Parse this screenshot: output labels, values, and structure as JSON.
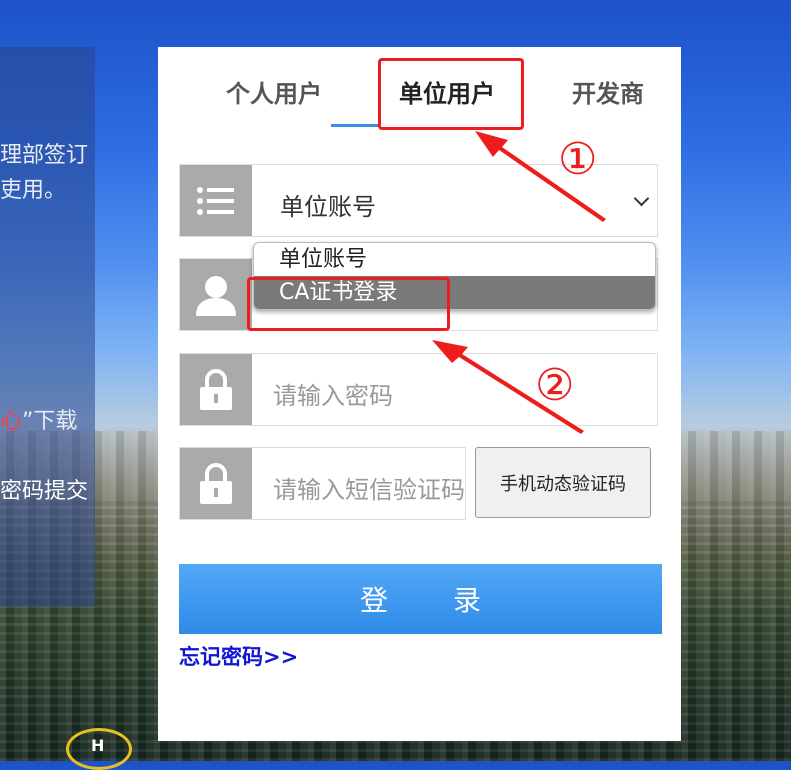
{
  "tabs": [
    {
      "label": "个人用户",
      "active": false
    },
    {
      "label": "单位用户",
      "active": true
    },
    {
      "label": "开发商",
      "active": false
    }
  ],
  "account_select": {
    "selected": "单位账号"
  },
  "dropdown": {
    "options": [
      "单位账号",
      "CA证书登录"
    ],
    "highlighted": "CA证书登录"
  },
  "password": {
    "placeholder": "请输入密码"
  },
  "sms": {
    "placeholder": "请输入短信验证码",
    "button": "手机动态验证码"
  },
  "login_button": "登 录",
  "forgot_link": "忘记密码>>",
  "left_panel": {
    "line1": "理部签订",
    "line2": "吏用。",
    "line3_red": "心",
    "line3_rest": "”下载",
    "line4": "密码提交"
  },
  "annotations": {
    "one": "①",
    "two": "②"
  },
  "colors": {
    "accent": "#3a8ee6",
    "annotation": "#ee1d1d",
    "link": "#0f14d6"
  },
  "icons": [
    "list-icon",
    "user-icon",
    "lock-icon",
    "chevron-down-icon"
  ]
}
